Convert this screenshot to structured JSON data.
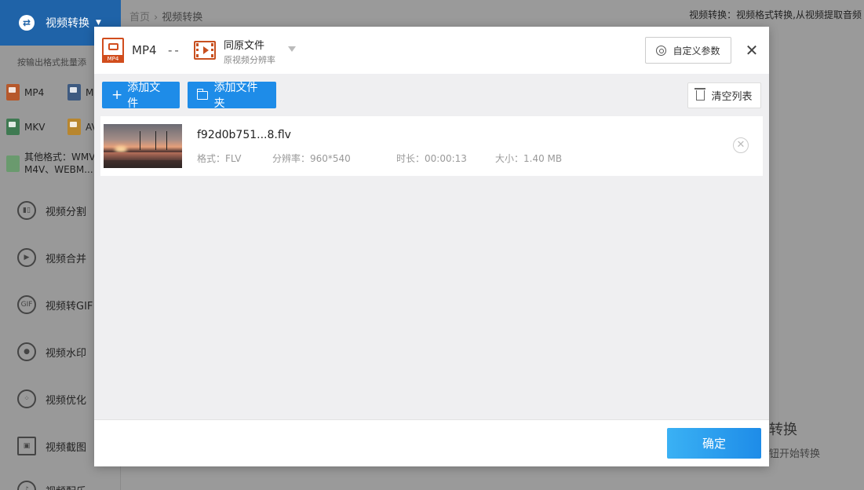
{
  "sidebar": {
    "header_label": "视频转换",
    "hint": "按输出格式批量添",
    "formats": [
      {
        "label": "MP4",
        "color": "#b6582b"
      },
      {
        "label": "M",
        "color": "#3e5a80"
      },
      {
        "label": "MKV",
        "color": "#3f7a52"
      },
      {
        "label": "AV",
        "color": "#b8862e"
      }
    ],
    "other_formats_line1": "其他格式：WMV",
    "other_formats_line2": "M4V、WEBM...",
    "nav": [
      {
        "label": "视频分割",
        "icon": "split-icon"
      },
      {
        "label": "视频合并",
        "icon": "merge-icon"
      },
      {
        "label": "视频转GIF",
        "icon": "gif-icon"
      },
      {
        "label": "视频水印",
        "icon": "watermark-icon"
      },
      {
        "label": "视频优化",
        "icon": "optimize-icon"
      },
      {
        "label": "视频截图",
        "icon": "screenshot-icon"
      },
      {
        "label": "视频配乐",
        "icon": "music-icon"
      }
    ]
  },
  "breadcrumb": {
    "home": "首页",
    "current": "视频转换"
  },
  "top_description": "视频转换：视频格式转换,从视频提取音频",
  "background_content": {
    "title": "转换",
    "subtitle": "钮开始转换"
  },
  "modal": {
    "output_format": "MP4",
    "output_format_badge": "MP4",
    "separator": "--",
    "resolution_title": "同原文件",
    "resolution_subtitle": "原视频分辨率",
    "custom_params_label": "自定义参数",
    "close_label": "✕",
    "toolbar": {
      "add_file_label": "添加文件",
      "add_folder_label": "添加文件夹",
      "clear_list_label": "清空列表"
    },
    "files": [
      {
        "name": "f92d0b751...8.flv",
        "format_label": "格式：FLV",
        "resolution_label": "分辨率：960*540",
        "duration_label": "时长：00:00:13",
        "size_label": "大小：1.40 MB"
      }
    ],
    "confirm_label": "确定"
  },
  "colors": {
    "accent": "#1e8ce8",
    "brand": "#1f63a8",
    "file_icon": "#d14d1d"
  }
}
